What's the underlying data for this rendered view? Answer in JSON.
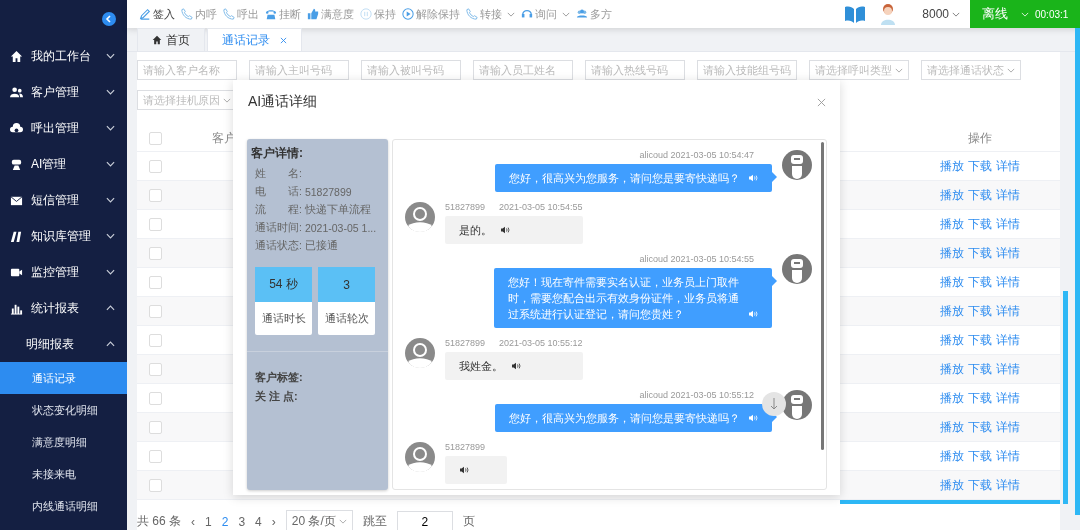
{
  "sidebar": {
    "items": [
      {
        "label": "我的工作台",
        "expanded": false
      },
      {
        "label": "客户管理",
        "expanded": false
      },
      {
        "label": "呼出管理",
        "expanded": false
      },
      {
        "label": "AI管理",
        "expanded": false
      },
      {
        "label": "短信管理",
        "expanded": false
      },
      {
        "label": "知识库管理",
        "expanded": false
      },
      {
        "label": "监控管理",
        "expanded": false
      },
      {
        "label": "统计报表",
        "expanded": true,
        "children": [
          {
            "label": "明细报表",
            "expanded": true,
            "children": [
              {
                "label": "通话记录",
                "selected": true
              },
              {
                "label": "状态变化明细",
                "selected": false
              },
              {
                "label": "满意度明细",
                "selected": false
              },
              {
                "label": "未接来电",
                "selected": false
              },
              {
                "label": "内线通话明细",
                "selected": false
              }
            ]
          }
        ]
      }
    ]
  },
  "toolbar": {
    "actions": [
      {
        "label": "签入",
        "disabled": false,
        "dropdown": false
      },
      {
        "label": "内呼",
        "disabled": true,
        "dropdown": false
      },
      {
        "label": "呼出",
        "disabled": true,
        "dropdown": false
      },
      {
        "label": "挂断",
        "disabled": true,
        "dropdown": false
      },
      {
        "label": "满意度",
        "disabled": true,
        "dropdown": false
      },
      {
        "label": "保持",
        "disabled": true,
        "dropdown": false
      },
      {
        "label": "解除保持",
        "disabled": true,
        "dropdown": false
      },
      {
        "label": "转接",
        "disabled": true,
        "dropdown": true
      },
      {
        "label": "询问",
        "disabled": true,
        "dropdown": true
      },
      {
        "label": "多方",
        "disabled": true,
        "dropdown": false
      }
    ]
  },
  "user": {
    "extension": "8000",
    "status": "离线",
    "timer": "00:03:1"
  },
  "tabs": [
    {
      "label": "首页",
      "selected": false,
      "closable": false
    },
    {
      "label": "通话记录",
      "selected": true,
      "closable": true
    }
  ],
  "filters": [
    {
      "kind": "input",
      "placeholder": "请输入客户名称"
    },
    {
      "kind": "input",
      "placeholder": "请输入主叫号码"
    },
    {
      "kind": "input",
      "placeholder": "请输入被叫号码"
    },
    {
      "kind": "input",
      "placeholder": "请输入员工姓名"
    },
    {
      "kind": "input",
      "placeholder": "请输入热线号码"
    },
    {
      "kind": "input",
      "placeholder": "请输入技能组号码"
    },
    {
      "kind": "select",
      "placeholder": "请选择呼叫类型"
    },
    {
      "kind": "select",
      "placeholder": "请选择通话状态"
    },
    {
      "kind": "select",
      "placeholder": "请选择挂机原因"
    }
  ],
  "table": {
    "columns": [
      "客户",
      "操作"
    ],
    "header_checked": false,
    "rows": [
      {
        "checked": false,
        "actions": [
          "播放",
          "下载",
          "详情"
        ]
      },
      {
        "checked": false,
        "actions": [
          "播放",
          "下载",
          "详情"
        ]
      },
      {
        "checked": false,
        "actions": [
          "播放",
          "下载",
          "详情"
        ]
      },
      {
        "checked": false,
        "actions": [
          "播放",
          "下载",
          "详情"
        ]
      },
      {
        "checked": false,
        "actions": [
          "播放",
          "下载",
          "详情"
        ]
      },
      {
        "checked": false,
        "actions": [
          "播放",
          "下载",
          "详情"
        ]
      },
      {
        "checked": false,
        "actions": [
          "播放",
          "下载",
          "详情"
        ]
      },
      {
        "checked": false,
        "actions": [
          "播放",
          "下载",
          "详情"
        ]
      },
      {
        "checked": false,
        "actions": [
          "播放",
          "下载",
          "详情"
        ]
      },
      {
        "checked": false,
        "actions": [
          "播放",
          "下载",
          "详情"
        ]
      },
      {
        "checked": false,
        "actions": [
          "播放",
          "下载",
          "详情"
        ]
      },
      {
        "checked": false,
        "actions": [
          "播放",
          "下载",
          "详情"
        ]
      }
    ]
  },
  "pagination": {
    "total": "共 66 条",
    "prev": "‹",
    "next": "›",
    "pages": [
      {
        "label": "1",
        "selected": false
      },
      {
        "label": "2",
        "selected": true
      },
      {
        "label": "3",
        "selected": false
      },
      {
        "label": "4",
        "selected": false
      }
    ],
    "page_size": "20 条/页",
    "jump_label": "跳至",
    "jump_value": "2",
    "page_unit": "页"
  },
  "dialog": {
    "title": "AI通话详细",
    "customer": {
      "heading": "客户详情:",
      "fields": [
        {
          "label": "姓　　名:"
        },
        {
          "label": "电　　话:",
          "value": "51827899"
        },
        {
          "label": "流　　程:",
          "value": "快递下单流程"
        },
        {
          "label": "通话时间:",
          "value": "2021-03-05 1..."
        },
        {
          "label": "通话状态:",
          "value": "已接通"
        }
      ],
      "stats": [
        {
          "value": "54 秒",
          "label": "通话时长"
        },
        {
          "value": "3",
          "label": "通话轮次"
        }
      ],
      "tags": [
        {
          "label": "客户标签:"
        },
        {
          "label": "关 注 点:"
        }
      ]
    },
    "messages": [
      {
        "kind": "agent",
        "sender": "alicoud",
        "time": "2021-03-05 10:54:47",
        "text": "您好，很高兴为您服务，请问您是要寄快递吗？"
      },
      {
        "kind": "customer",
        "sender": "51827899",
        "time": "2021-03-05 10:54:55",
        "text": "是的。"
      },
      {
        "kind": "agent",
        "sender": "alicoud",
        "time": "2021-03-05 10:54:55",
        "text": "您好！现在寄件需要实名认证，业务员上门取件时，需要您配合出示有效身份证件，业务员将通过系统进行认证登记，请问您贵姓？"
      },
      {
        "kind": "customer",
        "sender": "51827899",
        "time": "2021-03-05 10:55:12",
        "text": "我姓金。"
      },
      {
        "kind": "agent",
        "sender": "alicoud",
        "time": "2021-03-05 10:55:12",
        "text": "您好，很高兴为您服务，请问您是要寄快递吗？"
      },
      {
        "kind": "customer",
        "sender": "51827899"
      }
    ]
  }
}
